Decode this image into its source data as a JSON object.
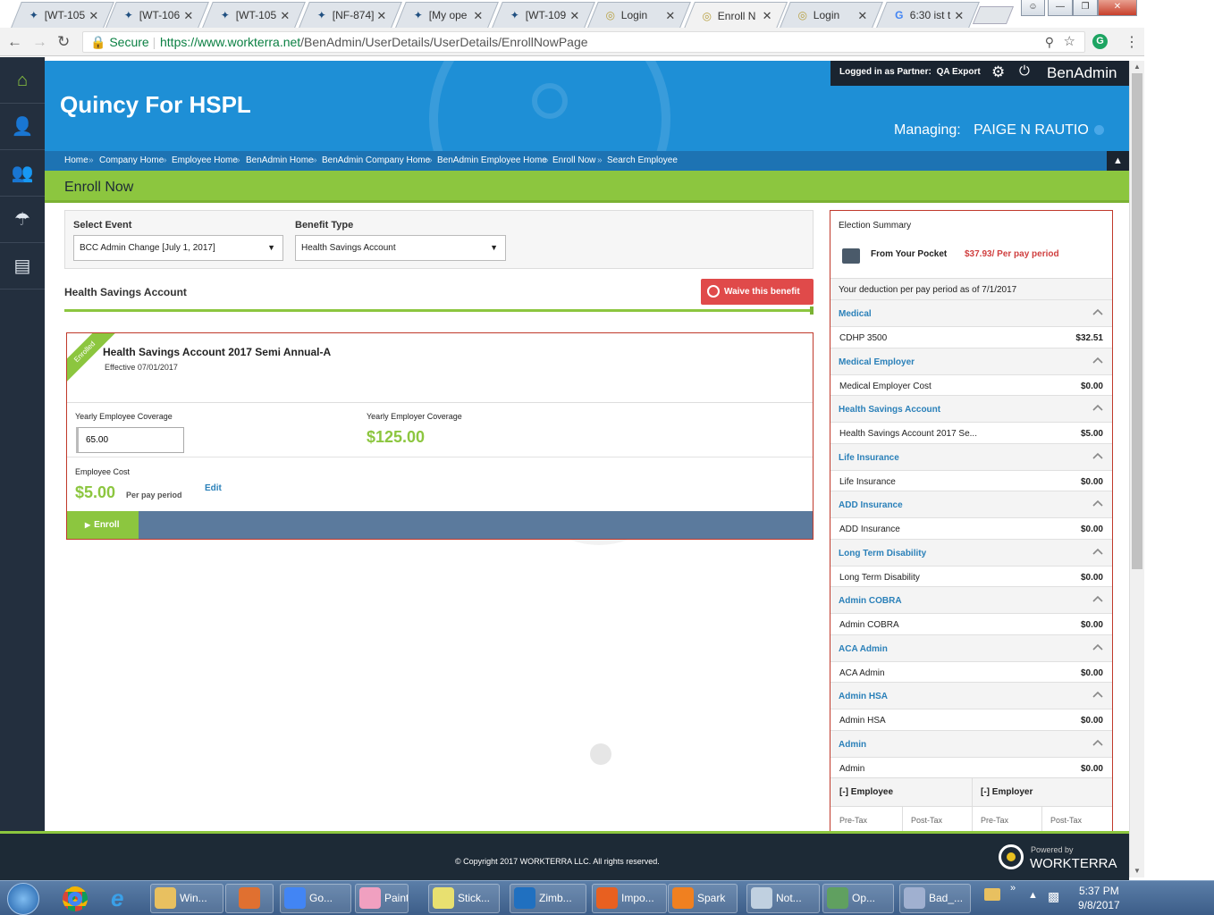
{
  "browser": {
    "tabs": [
      {
        "label": "[WT-105",
        "icon": "jira-icon",
        "active": false
      },
      {
        "label": "[WT-106",
        "icon": "jira-icon",
        "active": false
      },
      {
        "label": "[WT-105",
        "icon": "jira-icon",
        "active": false
      },
      {
        "label": "[NF-874]",
        "icon": "jira-icon",
        "active": false
      },
      {
        "label": "[My ope",
        "icon": "jira-icon",
        "active": false
      },
      {
        "label": "[WT-109",
        "icon": "jira-icon",
        "active": false
      },
      {
        "label": "Login",
        "icon": "login-icon",
        "active": false
      },
      {
        "label": "Enroll N",
        "icon": "login-icon",
        "active": true
      },
      {
        "label": "Login",
        "icon": "login-icon",
        "active": false
      },
      {
        "label": "6:30 ist t",
        "icon": "google-icon",
        "active": false
      }
    ],
    "secure_label": "Secure",
    "url_host": "https://www.workterra.net",
    "url_path": "/BenAdmin/UserDetails/UserDetails/EnrollNowPage"
  },
  "header": {
    "company": "Quincy For HSPL",
    "logged_in_prefix": "Logged in as",
    "logged_in_role": "Partner:",
    "logged_in_name": "QA Export",
    "app_name": "BenAdmin",
    "managing_label": "Managing:",
    "managing_name": "PAIGE N RAUTIO"
  },
  "breadcrumbs": [
    "Home",
    "Company Home",
    "Employee Home",
    "BenAdmin Home",
    "BenAdmin Company Home",
    "BenAdmin Employee Home",
    "Enroll Now",
    "Search Employee"
  ],
  "page_title": "Enroll Now",
  "filters": {
    "event_label": "Select Event",
    "event_value": "BCC Admin Change [July 1, 2017]",
    "benefit_label": "Benefit Type",
    "benefit_value": "Health Savings Account"
  },
  "section_title": "Health Savings Account",
  "waive_label": "Waive this benefit",
  "plan": {
    "ribbon": "Enrolled",
    "name": "Health Savings Account 2017 Semi Annual-A",
    "effective": "Effective 07/01/2017",
    "emp_cov_label": "Yearly Employee Coverage",
    "emp_cov_value": "65.00",
    "er_cov_label": "Yearly Employer Coverage",
    "er_cov_value": "$125.00",
    "cost_label": "Employee Cost",
    "cost_value": "$5.00",
    "cost_period": "Per pay period",
    "edit_label": "Edit",
    "enroll_label": "Enroll"
  },
  "summary": {
    "title": "Election Summary",
    "pocket_label": "From Your Pocket",
    "pocket_value": "$37.93/ Per pay period",
    "deduction_note": "Your deduction per pay period as of 7/1/2017",
    "groups": [
      {
        "name": "Medical",
        "item": "CDHP 3500",
        "value": "$32.51"
      },
      {
        "name": "Medical Employer",
        "item": "Medical Employer Cost",
        "value": "$0.00"
      },
      {
        "name": "Health Savings Account",
        "item": "Health Savings Account 2017 Se...",
        "value": "$5.00"
      },
      {
        "name": "Life Insurance",
        "item": "Life Insurance",
        "value": "$0.00"
      },
      {
        "name": "ADD Insurance",
        "item": "ADD Insurance",
        "value": "$0.00"
      },
      {
        "name": "Long Term Disability",
        "item": "Long Term Disability",
        "value": "$0.00"
      },
      {
        "name": "Admin COBRA",
        "item": "Admin COBRA",
        "value": "$0.00"
      },
      {
        "name": "ACA Admin",
        "item": "ACA Admin",
        "value": "$0.00"
      },
      {
        "name": "Admin HSA",
        "item": "Admin HSA",
        "value": "$0.00"
      },
      {
        "name": "Admin",
        "item": "Admin",
        "value": "$0.00"
      }
    ],
    "employee_toggle": "[-] Employee",
    "employer_toggle": "[-] Employer",
    "tax_cols": [
      "Pre-Tax",
      "Post-Tax",
      "Pre-Tax",
      "Post-Tax"
    ]
  },
  "footer": {
    "copyright": "© Copyright 2017 WORKTERRA LLC. All rights reserved.",
    "powered_by": "Powered by",
    "brand": "WORKTERRA"
  },
  "taskbar": {
    "items": [
      "Win...",
      "Go...",
      "Paint",
      "Stick...",
      "Zimb...",
      "Impo...",
      "Spark",
      "Not...",
      "Op...",
      "Bad_..."
    ],
    "time": "5:37 PM",
    "date": "9/8/2017"
  },
  "colors": {
    "accent_green": "#8cc63f",
    "header_blue": "#1e8fd6",
    "link_blue": "#2a80b9",
    "alert_red": "#e04040"
  }
}
